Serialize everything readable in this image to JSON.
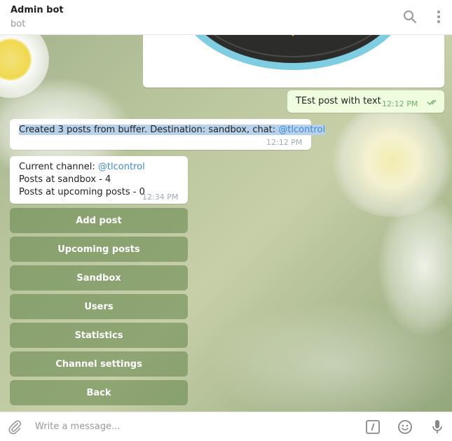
{
  "header": {
    "title": "Admin bot",
    "subtitle": "bot",
    "icons": [
      "search-icon",
      "more-vertical-icon"
    ]
  },
  "messages": {
    "outgoing_text": "TEst post with text",
    "outgoing_time": "12:12 PM",
    "created": {
      "text": "Created 3 posts from buffer. Destination: sandbox, chat: ",
      "link": "@tlcontrol",
      "time": "12:12 PM"
    },
    "status": {
      "line1_label": "Current channel:  ",
      "line1_link": "@tlcontrol",
      "line2": "Posts at sandbox - 4",
      "line3": "Posts at upcoming posts - 0",
      "time": "12:34 PM"
    }
  },
  "keyboard": {
    "buttons": [
      "Add post",
      "Upcoming posts",
      "Sandbox",
      "Users",
      "Statistics",
      "Channel settings",
      "Back"
    ]
  },
  "composer": {
    "placeholder": "Write a message...",
    "icons": [
      "attach-icon",
      "bot-command-icon",
      "emoji-icon",
      "microphone-icon"
    ]
  },
  "colors": {
    "link": "#3d8bd3",
    "selection": "#b8d2ec",
    "outgoing_bubble": "#effdde",
    "keyboard_button": "#608348"
  }
}
